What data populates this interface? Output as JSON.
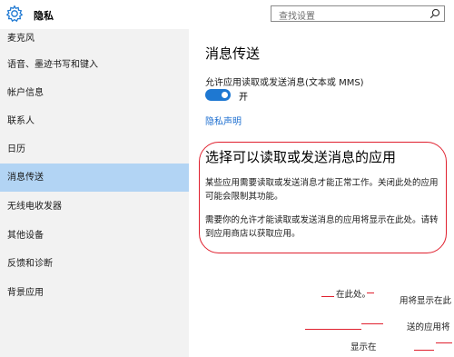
{
  "header": {
    "title": "隐私",
    "search_placeholder": "查找设置"
  },
  "sidebar": {
    "items": [
      {
        "label": "麦克风"
      },
      {
        "label": "语音、墨迹书写和键入"
      },
      {
        "label": "帐户信息"
      },
      {
        "label": "联系人"
      },
      {
        "label": "日历"
      },
      {
        "label": "消息传送"
      },
      {
        "label": "无线电收发器"
      },
      {
        "label": "其他设备"
      },
      {
        "label": "反馈和诊断"
      },
      {
        "label": "背景应用"
      }
    ],
    "active_index": 5
  },
  "main": {
    "title": "消息传送",
    "setting_label": "允许应用读取或发送消息(文本或 MMS)",
    "toggle_state": "开",
    "privacy_link": "隐私声明",
    "section_title": "选择可以读取或发送消息的应用",
    "para1": "某些应用需要读取或发送消息才能正常工作。关闭此处的应用可能会限制其功能。",
    "para2": "需要你的允许才能读取或发送消息的应用将显示在此处。请转到应用商店以获取应用。"
  },
  "fragments": {
    "f1": "在此处。",
    "f2": "用将显示在此",
    "f3": "送的应用将",
    "f4": "显示在"
  },
  "colors": {
    "accent": "#1e78d2",
    "sidebar_bg": "#f2f2f2",
    "active_bg": "#b2d4f4",
    "annotation_red": "#e0202e"
  }
}
